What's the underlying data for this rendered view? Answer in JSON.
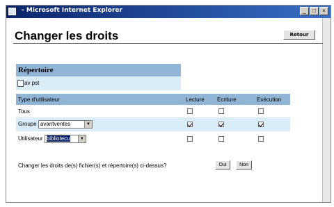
{
  "window": {
    "title": "- Microsoft Internet Explorer"
  },
  "toolbar": {
    "retour_label": "Retour"
  },
  "page": {
    "title": "Changer les droits"
  },
  "repertoire": {
    "header": "Répertoire",
    "item": "av pst"
  },
  "permissions": {
    "headers": [
      "Type d'utilisateur",
      "Lecture",
      "Ecriture",
      "Exécution"
    ],
    "rows": [
      {
        "label": "Tous",
        "checked": [
          false,
          false,
          false
        ]
      },
      {
        "label": "Groupe",
        "select_value": "avantventes",
        "checked": [
          true,
          true,
          true
        ]
      },
      {
        "label": "Utilisateur",
        "select_value": "bibliotecu",
        "checked": [
          false,
          false,
          false
        ]
      }
    ]
  },
  "confirm": {
    "question": "Changer les droits de(s) fichier(s) et répertoire(s) ci-dessus?",
    "yes_label": "Oui",
    "no_label": "Non"
  }
}
